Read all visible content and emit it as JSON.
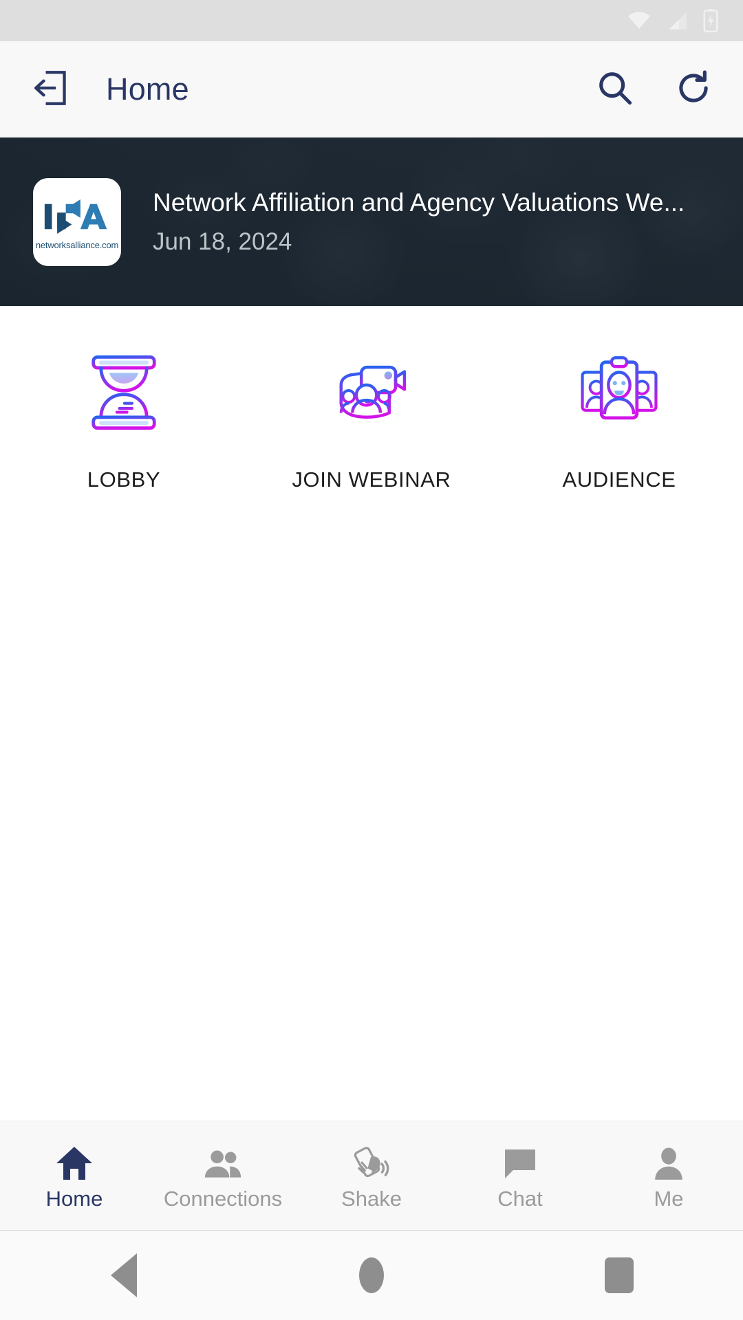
{
  "status_bar": {
    "wifi_icon": "wifi-full-icon",
    "cellular_icon": "cellular-signal-icon",
    "battery_icon": "battery-charging-icon",
    "background": "#dedede"
  },
  "app_bar": {
    "exit_icon": "exit-logout-icon",
    "title": "Home",
    "search_icon": "search-icon",
    "refresh_icon": "refresh-icon",
    "title_color": "#2a3765",
    "background": "#f8f8f8"
  },
  "banner": {
    "logo": {
      "letters": "INA",
      "domain": "networksalliance.com",
      "brand_color": "#2e7cb4",
      "dark_color": "#1d4d73"
    },
    "title": "Network Affiliation and Agency Valuations We...",
    "date": "Jun 18, 2024",
    "overlay_color": "#1a242e"
  },
  "actions": [
    {
      "id": "lobby",
      "label": "LOBBY",
      "icon": "hourglass-icon"
    },
    {
      "id": "join-webinar",
      "label": "JOIN WEBINAR",
      "icon": "video-camera-people-icon"
    },
    {
      "id": "audience",
      "label": "AUDIENCE",
      "icon": "audience-badges-icon"
    }
  ],
  "action_icon_gradient": {
    "from": "#2563f0",
    "to": "#d313e8"
  },
  "bottom_nav": {
    "active_color": "#2a3765",
    "inactive_color": "#9b9b9b",
    "items": [
      {
        "id": "home",
        "label": "Home",
        "icon": "home-icon",
        "active": true
      },
      {
        "id": "connections",
        "label": "Connections",
        "icon": "people-icon",
        "active": false
      },
      {
        "id": "shake",
        "label": "Shake",
        "icon": "shake-phone-icon",
        "active": false
      },
      {
        "id": "chat",
        "label": "Chat",
        "icon": "chat-bubble-icon",
        "active": false
      },
      {
        "id": "me",
        "label": "Me",
        "icon": "person-icon",
        "active": false
      }
    ]
  },
  "system_nav": {
    "back_icon": "android-back-icon",
    "home_icon": "android-home-icon",
    "recents_icon": "android-recents-icon"
  }
}
